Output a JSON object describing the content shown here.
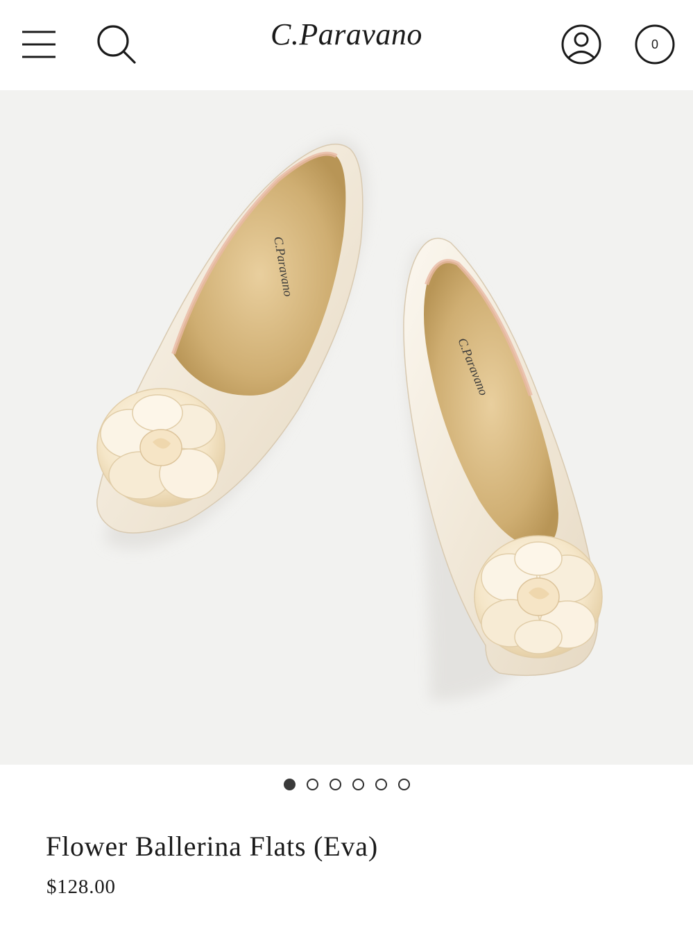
{
  "header": {
    "brand": "C.Paravano",
    "cart_count": "0",
    "icons": {
      "menu": "hamburger-menu-icon",
      "search": "search-icon",
      "account": "account-icon",
      "cart": "cart-icon"
    }
  },
  "product_image": {
    "insole_brand": "C.Paravano",
    "background_color": "#f2f2f0",
    "shoe_color": "#f3ece0"
  },
  "carousel": {
    "total": 6,
    "active_index": 0
  },
  "product": {
    "title": "Flower Ballerina Flats (Eva)",
    "price": "$128.00"
  }
}
